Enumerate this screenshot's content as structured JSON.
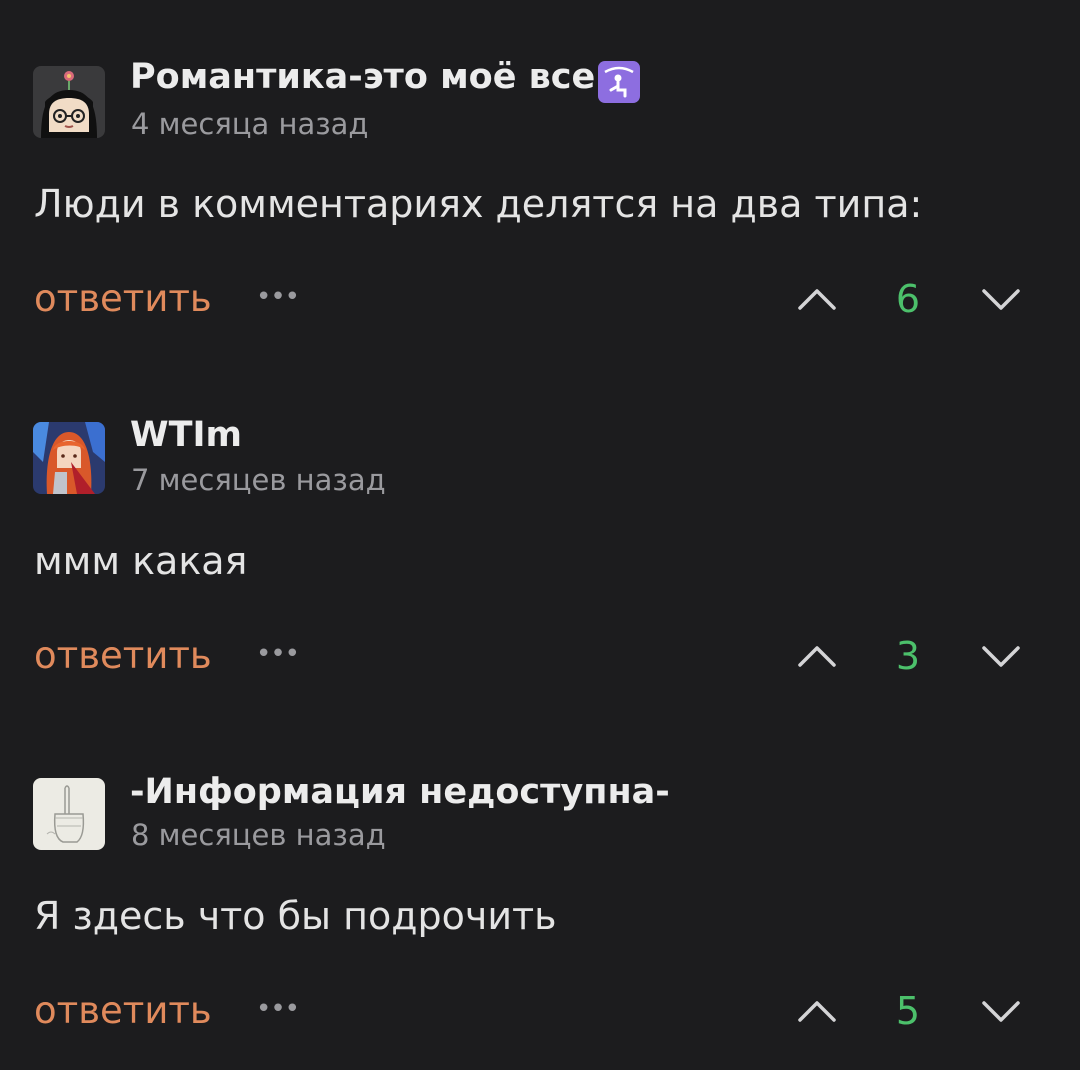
{
  "reply_label": "ответить",
  "more_label": "•••",
  "colors": {
    "background": "#1c1c1e",
    "reply": "#e08a5c",
    "score": "#4cc06b",
    "muted": "#9a9a9e"
  },
  "comments": [
    {
      "username": "Романтика-это моё все",
      "badge_icon": "person-kneeling-icon",
      "timestamp": "4 месяца назад",
      "text": "Люди в комментариях делятся на два типа:",
      "score": "6"
    },
    {
      "username": "WTIm",
      "timestamp": "7 месяцев назад",
      "text": "ммм какая",
      "score": "3"
    },
    {
      "username": "-Информация недоступна-",
      "timestamp": "8 месяцев назад",
      "text": "Я здесь что бы подрочить",
      "score": "5"
    }
  ]
}
